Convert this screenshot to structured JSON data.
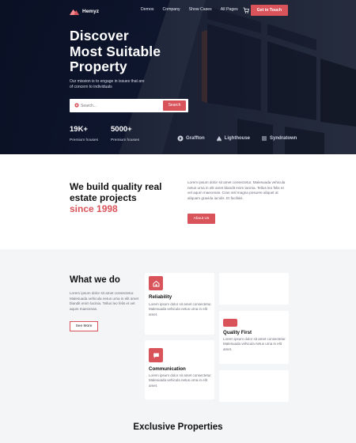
{
  "nav": {
    "brand": "Hemyz",
    "links": [
      "Demos",
      "Company",
      "Show Cases",
      "All Pages"
    ],
    "cta": "Get in Touch"
  },
  "hero": {
    "title_lines": [
      "Discover",
      "Most Suitable",
      "Property"
    ],
    "subtitle": "Our mission is to engage in issues that are of concern to individuals",
    "search_placeholder": "Search...",
    "search_button": "Search",
    "stats": [
      {
        "value": "19K+",
        "label": "Premium houses"
      },
      {
        "value": "5000+",
        "label": "Premium houses"
      }
    ],
    "partners": [
      "Graffton",
      "Lighthouse",
      "Syndratown"
    ]
  },
  "build": {
    "title_main": "We build quality real estate projects",
    "title_accent": "since 1998",
    "paragraph": "Lorem ipsum dolor sit amet consectetur. Malesuada vehicula netus urna in elit amet blandit enim lacinia. Tellus leo felis et vel aqum maecenas. Cras nisl magna posuere aliquet at aliquam gravida iaculis. Et facilisis.",
    "button": "About Us"
  },
  "what_we_do": {
    "title": "What we do",
    "paragraph": "Lorem ipsum dolor sit amet consectetur. Malesuada vehicula netus urna in elit amet blandit enim lacinia. Tellus leo felis et vel aqum maecenas.",
    "button": "See More",
    "cards": [
      {
        "title": "Reliability",
        "text": "Lorem ipsum dolor sit amet consectetur. Malesuada vehicula netus urna in elit amet.",
        "icon": "home-icon"
      },
      {
        "title": "Quality First",
        "text": "Lorem ipsum dolor sit amet consectetur. Malesuada vehicula netus urna in elit amet.",
        "icon": "badge-icon"
      },
      {
        "title": "Communication",
        "text": "Lorem ipsum dolor sit amet consectetur. Malesuada vehicula netus urna in elit amet.",
        "icon": "chat-icon"
      }
    ]
  },
  "exclusive": {
    "title": "Exclusive Properties"
  },
  "colors": {
    "accent": "#d9535a",
    "hero_bg": "#0e1730"
  }
}
